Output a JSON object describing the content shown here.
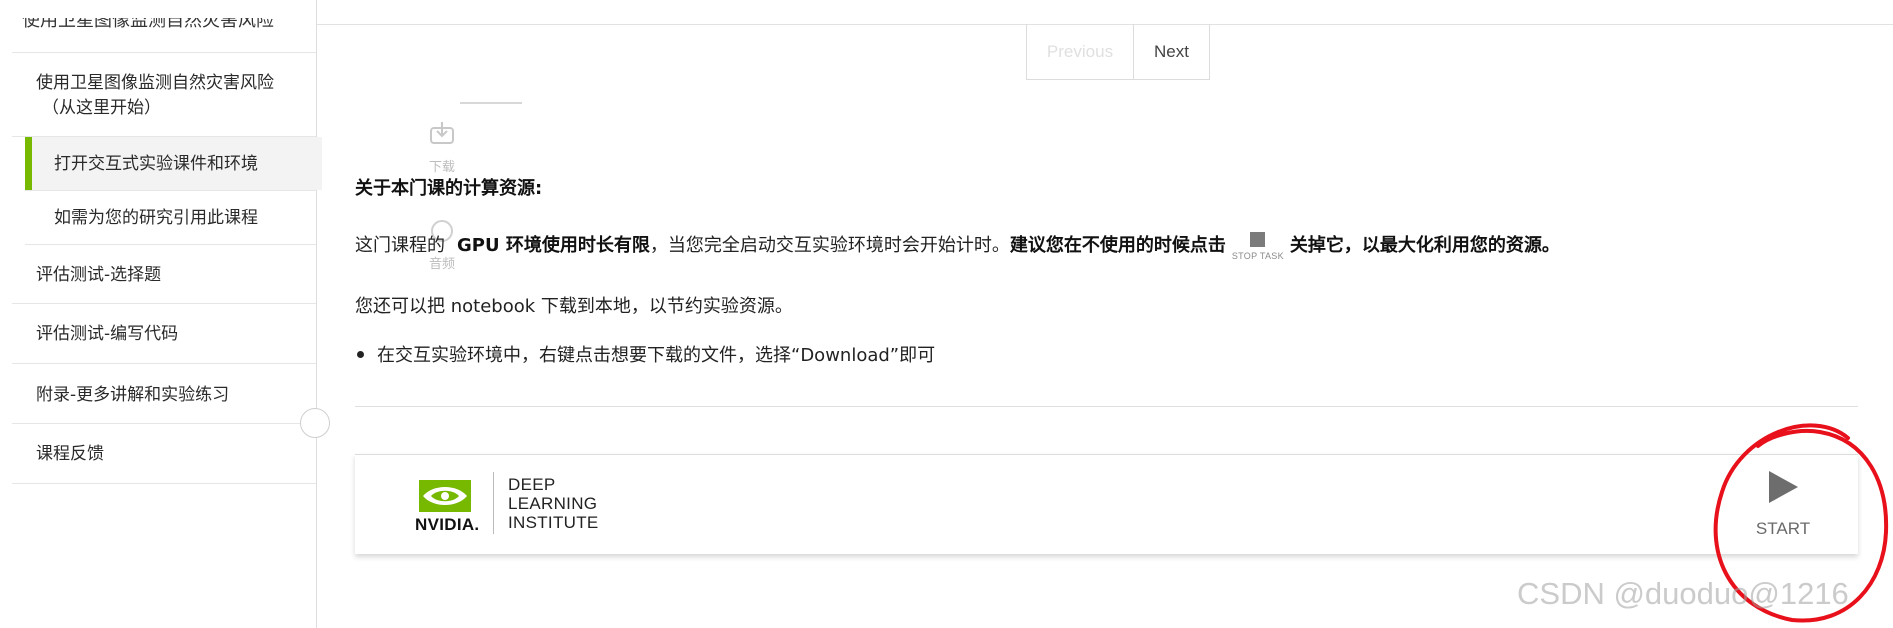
{
  "sidebar": {
    "items": [
      {
        "label": "使用卫星图像监测自然灾害风险"
      },
      {
        "label": "使用卫星图像监测自然灾害风险（从这里开始）",
        "line1": "使用卫星图像监测自然灾害风险",
        "line2": "（从这里开始）"
      },
      {
        "label": "打开交互式实验课件和环境",
        "active": true
      },
      {
        "label": "如需为您的研究引用此课程"
      },
      {
        "label": "评估测试-选择题"
      },
      {
        "label": "评估测试-编写代码"
      },
      {
        "label": "附录-更多讲解和实验练习"
      },
      {
        "label": "课程反馈"
      }
    ],
    "accent_color": "#76b900"
  },
  "pager": {
    "previous": "Previous",
    "next": "Next"
  },
  "floating_icons": {
    "download_label": "下载",
    "other_label": "音频"
  },
  "content": {
    "heading": "关于本门课的计算资源:",
    "p1_a": "这门课程的",
    "p1_b": "GPU 环境使用时长有限",
    "p1_c": "，当您完全启动交互实验环境时会开始计时。",
    "p1_d": "建议您在不使用的时候点击",
    "stop_task_label": "STOP TASK",
    "p1_e": "关掉它，以最大化利用您的资源。",
    "p2": "您还可以把 notebook 下载到本地，以节约实验资源。",
    "bullet": "在交互实验环境中，右键点击想要下载的文件，选择“Download”即可"
  },
  "footer": {
    "nvidia": "NVIDIA.",
    "dli_line1": "DEEP",
    "dli_line2": "LEARNING",
    "dli_line3": "INSTITUTE",
    "start_label": "START"
  },
  "watermark": "CSDN @duoduo@1216",
  "colors": {
    "nvidia_green": "#76b900",
    "annotation_red": "#e8101a"
  }
}
